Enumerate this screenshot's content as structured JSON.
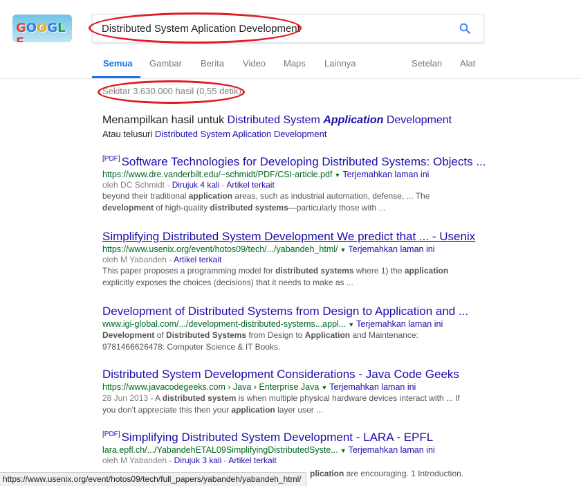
{
  "logo": {
    "letters": [
      "G",
      "O",
      "O",
      "G",
      "L",
      "E"
    ],
    "colors": [
      "#e0433a",
      "#3b7dd8",
      "#f2b01e",
      "#3b7dd8",
      "#2e9b46",
      "#e0433a"
    ]
  },
  "search": {
    "value": "Distributed System Aplication Development",
    "icon": "search-icon"
  },
  "tabs": [
    {
      "label": "Semua",
      "active": true
    },
    {
      "label": "Gambar"
    },
    {
      "label": "Berita"
    },
    {
      "label": "Video"
    },
    {
      "label": "Maps"
    },
    {
      "label": "Lainnya"
    },
    {
      "label": "Setelan"
    },
    {
      "label": "Alat"
    }
  ],
  "stats": "Sekitar 3.630.000 hasil (0,55 detik)",
  "correction": {
    "showing_prefix": "Menampilkan hasil untuk",
    "showing_link_a": "Distributed System",
    "showing_link_bold": "Application",
    "showing_link_b": "Development",
    "instead_prefix": "Atau telusuri",
    "instead_link": "Distributed System Aplication Development"
  },
  "results": [
    {
      "pdf": "[PDF]",
      "title": "Software Technologies for Developing Distributed Systems: Objects ...",
      "url": "https://www.dre.vanderbilt.edu/~schmidt/PDF/CSI-article.pdf",
      "translate": "Terjemahkan laman ini",
      "meta_author": "oleh DC Schmidt - ",
      "meta_cited": "Dirujuk 4 kali",
      "meta_sep": " - ",
      "meta_related": "Artikel terkait",
      "snippet_1a": "beyond their traditional ",
      "snippet_1b": "application",
      "snippet_1c": " areas, such as industrial automation, defense, ... The",
      "snippet_2a": "development",
      "snippet_2b": " of high-quality ",
      "snippet_2c": "distributed systems",
      "snippet_2d": "—particularly those with ..."
    },
    {
      "title": "Simplifying Distributed System Development We predict that ... - Usenix",
      "url": "https://www.usenix.org/event/hotos09/tech/.../yabandeh_html/",
      "translate": "Terjemahkan laman ini",
      "meta_author": "oleh M Yabandeh - ",
      "meta_related": "Artikel terkait",
      "snippet_1a": "This paper proposes a programming model for ",
      "snippet_1b": "distributed systems",
      "snippet_1c": " where 1) the ",
      "snippet_1d": "application",
      "snippet_2a": "explicitly exposes the choices (decisions) that it needs to make as ..."
    },
    {
      "title": "Development of Distributed Systems from Design to Application and ...",
      "url": "www.igi-global.com/.../development-distributed-systems...appl...",
      "translate": "Terjemahkan laman ini",
      "snippet_1a": "Development",
      "snippet_1b": " of ",
      "snippet_1c": "Distributed Systems",
      "snippet_1d": " from Design to ",
      "snippet_1e": "Application",
      "snippet_1f": " and Maintenance:",
      "snippet_2a": "9781466626478: Computer Science & IT Books."
    },
    {
      "title": "Distributed System Development Considerations - Java Code Geeks",
      "url": "https://www.javacodegeeks.com › Java › Enterprise Java",
      "translate": "Terjemahkan laman ini",
      "date": "28 Jun 2013",
      "snippet_1a": " - A ",
      "snippet_1b": "distributed system",
      "snippet_1c": " is when multiple physical hardware devices interact with ... If",
      "snippet_2a": "you don't appreciate this then your ",
      "snippet_2b": "application",
      "snippet_2c": " layer user ..."
    },
    {
      "pdf": "[PDF]",
      "title": "Simplifying Distributed System Development - LARA - EPFL",
      "url": "lara.epfl.ch/.../YabandehETAL09SimplifyingDistributedSyste...",
      "translate": "Terjemahkan laman ini",
      "meta_author": "oleh M Yabandeh - ",
      "meta_cited": "Dirujuk 3 kali",
      "meta_sep": " - ",
      "meta_related": "Artikel terkait",
      "snippet_1b": "plication",
      "snippet_1c": " are encouraging. 1 Introduction."
    }
  ],
  "status_bar": "https://www.usenix.org/event/hotos09/tech/full_papers/yabandeh/yabandeh_html/",
  "annotation_color": "#e21b23"
}
